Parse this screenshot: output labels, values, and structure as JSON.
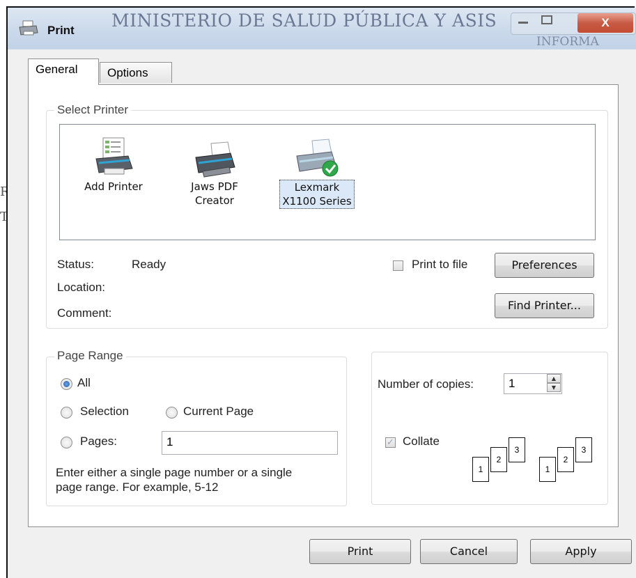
{
  "window": {
    "title": "Print",
    "background_heading": "MINISTERIO DE SALUD PÚBLICA Y ASIS",
    "background_subheading": "INFORMA",
    "edge_letters": [
      "R",
      "T"
    ],
    "close_glyph": "X"
  },
  "tabs": [
    {
      "label": "General",
      "selected": true
    },
    {
      "label": "Options",
      "selected": false
    }
  ],
  "select_printer": {
    "legend": "Select Printer",
    "printers": [
      {
        "line1": "Add Printer",
        "line2": "",
        "icon": "add-printer-icon"
      },
      {
        "line1": "Jaws PDF",
        "line2": "Creator",
        "icon": "printer-icon"
      },
      {
        "line1": "Lexmark",
        "line2": "X1100 Series",
        "icon": "default-printer-icon",
        "selected": true
      }
    ],
    "status_label": "Status:",
    "status_value": "Ready",
    "location_label": "Location:",
    "comment_label": "Comment:",
    "print_to_file_label": "Print to file",
    "print_to_file_checked": false,
    "preferences_button": "Preferences",
    "find_printer_button": "Find Printer..."
  },
  "page_range": {
    "legend": "Page Range",
    "all_label": "All",
    "selection_label": "Selection",
    "current_page_label": "Current Page",
    "pages_label": "Pages:",
    "pages_value": "1",
    "selected_option": "All",
    "hint_line1": "Enter either a single page number or a single",
    "hint_line2": "page range.  For example, 5-12"
  },
  "copies": {
    "number_label": "Number of copies:",
    "number_value": "1",
    "collate_label": "Collate",
    "collate_checked": true,
    "collate_pages": [
      "1",
      "2",
      "3"
    ]
  },
  "footer": {
    "print_button": "Print",
    "cancel_button": "Cancel",
    "apply_button": "Apply"
  }
}
